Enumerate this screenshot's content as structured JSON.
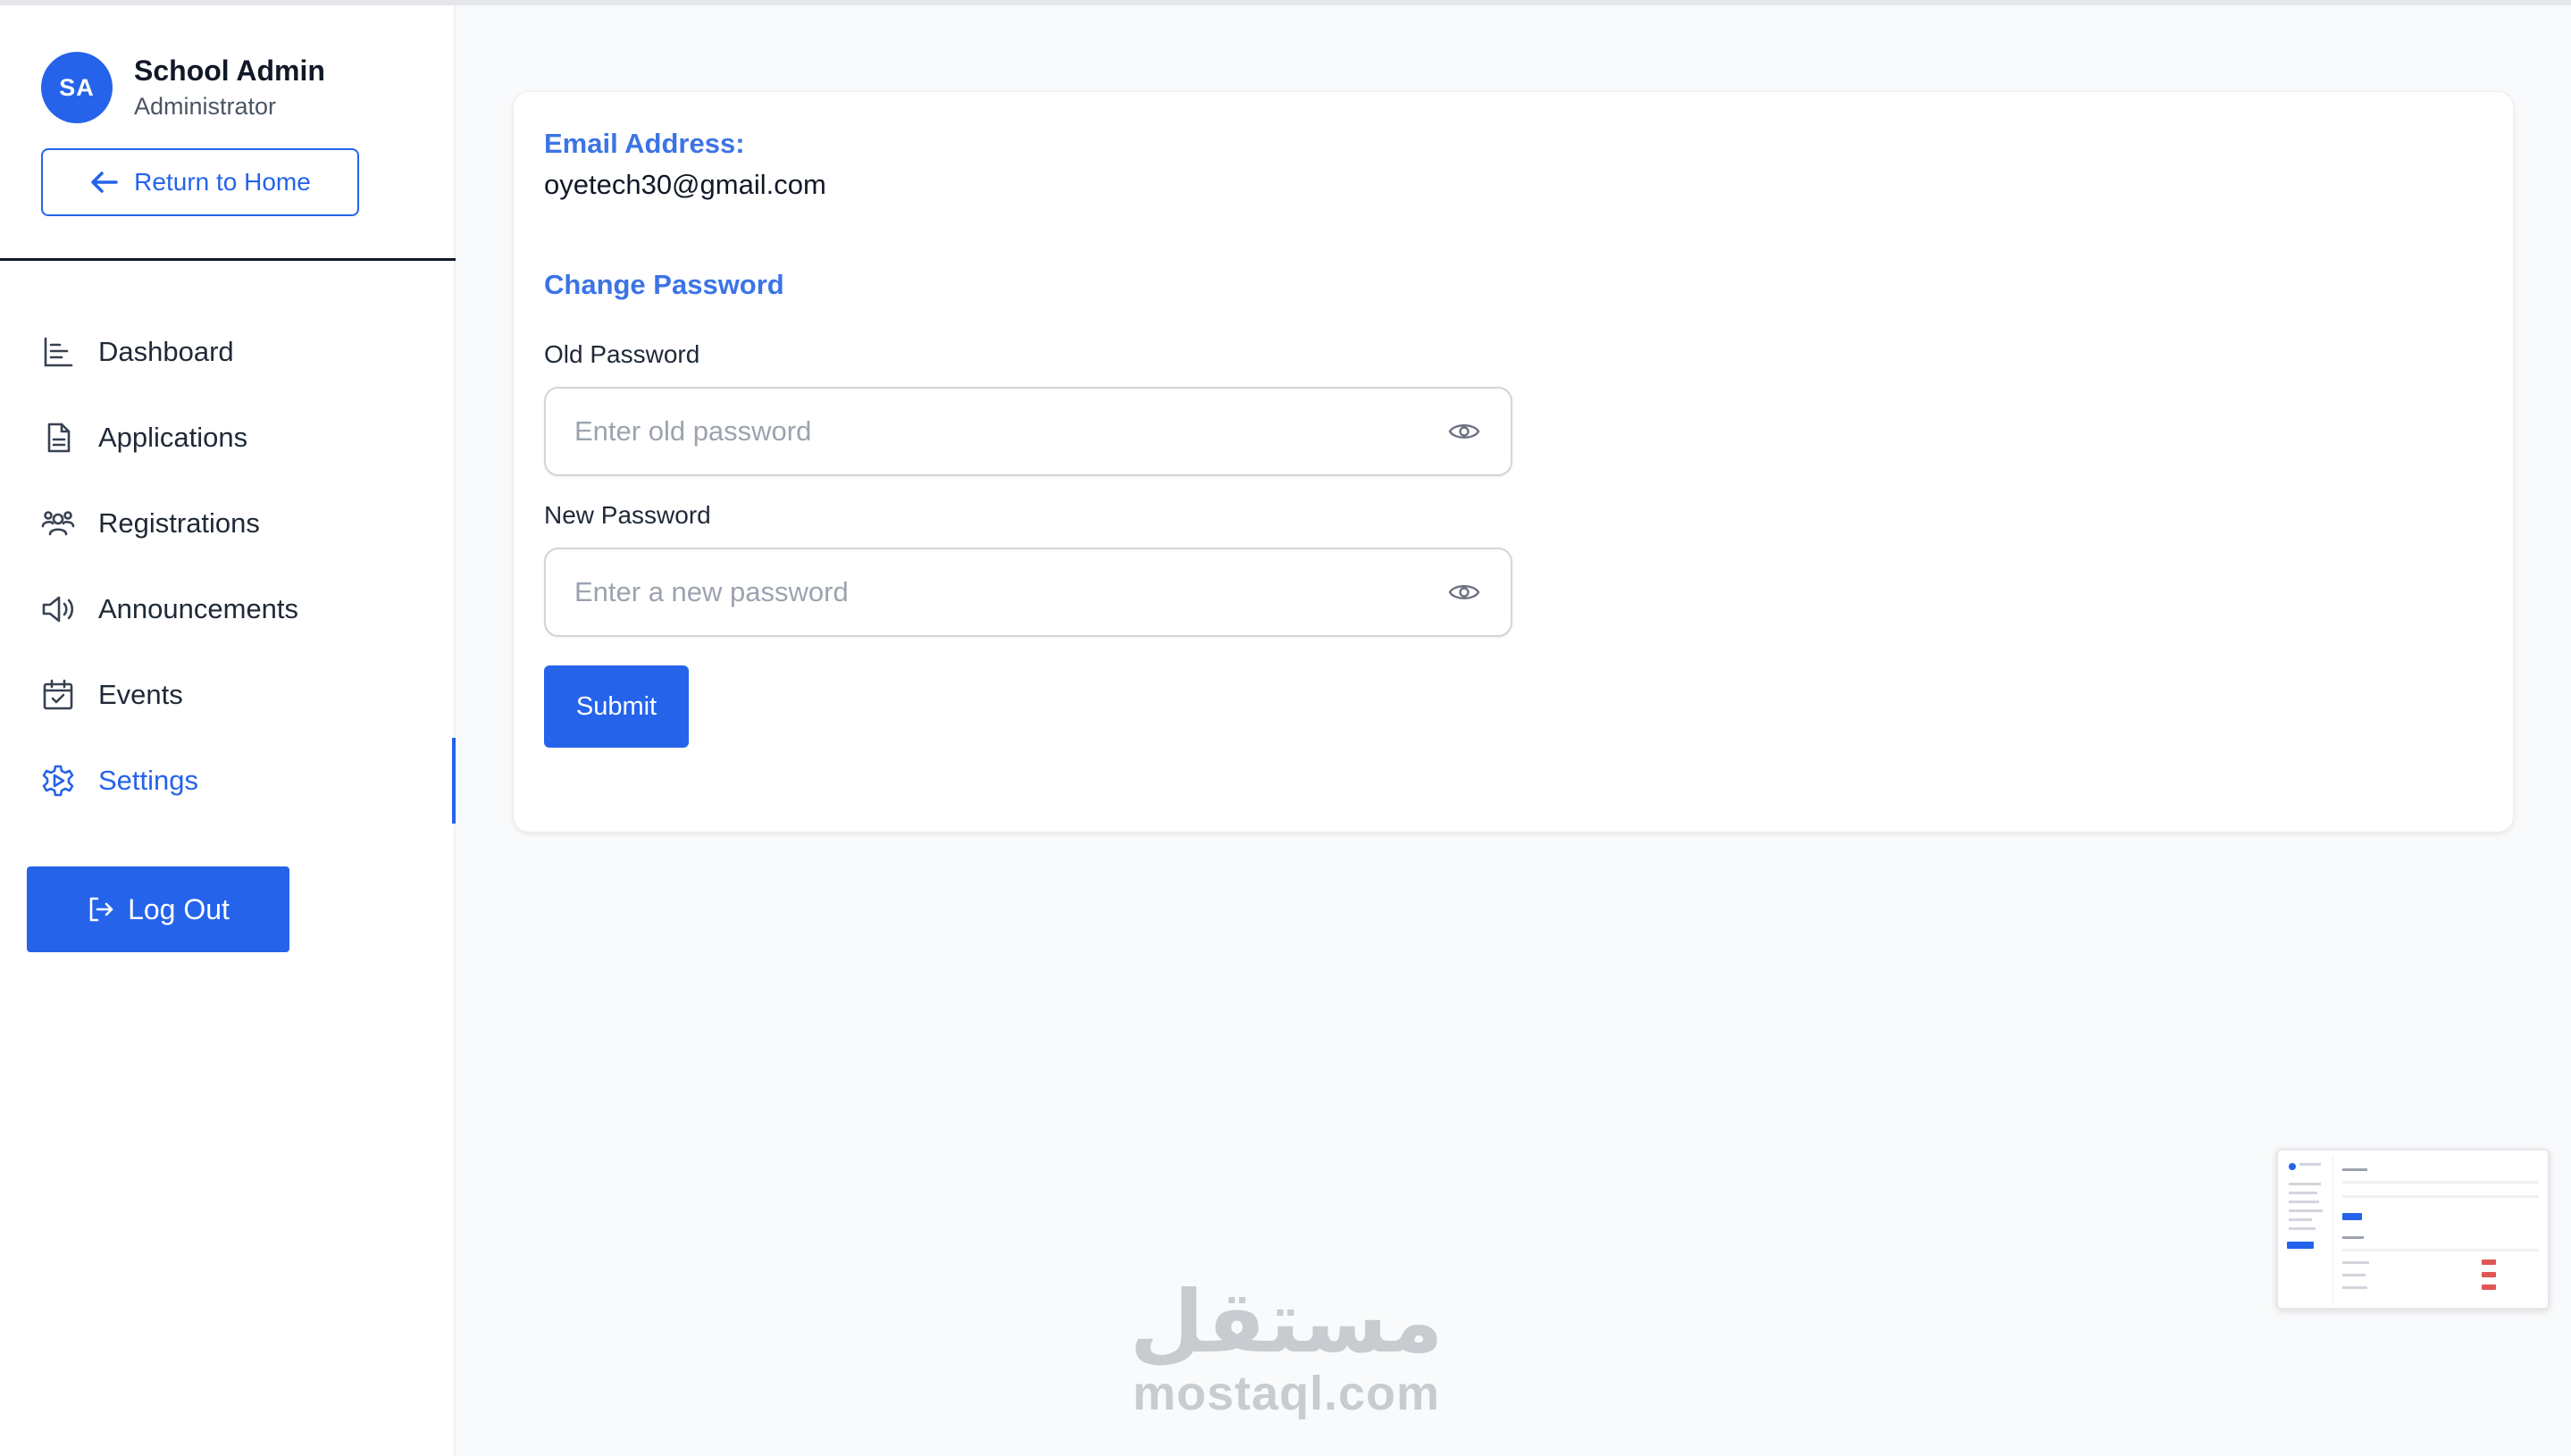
{
  "profile": {
    "initials": "SA",
    "name": "School Admin",
    "role": "Administrator",
    "return_label": "Return to Home"
  },
  "nav": {
    "items": [
      {
        "label": "Dashboard",
        "icon": "bar-chart-icon"
      },
      {
        "label": "Applications",
        "icon": "document-icon"
      },
      {
        "label": "Registrations",
        "icon": "users-icon"
      },
      {
        "label": "Announcements",
        "icon": "megaphone-icon"
      },
      {
        "label": "Events",
        "icon": "calendar-check-icon"
      },
      {
        "label": "Settings",
        "icon": "gear-icon",
        "active": true
      }
    ],
    "logout_label": "Log Out"
  },
  "settings": {
    "email_label": "Email Address:",
    "email_value": "oyetech30@gmail.com",
    "change_password_label": "Change Password",
    "old_password_label": "Old Password",
    "old_password_placeholder": "Enter old password",
    "new_password_label": "New Password",
    "new_password_placeholder": "Enter a new password",
    "submit_label": "Submit"
  },
  "watermark": {
    "arabic": "مستقل",
    "latin": "mostaql.com"
  },
  "colors": {
    "accent": "#2563eb",
    "label_blue": "#3b74e6",
    "page_bg": "#f9fafb"
  }
}
